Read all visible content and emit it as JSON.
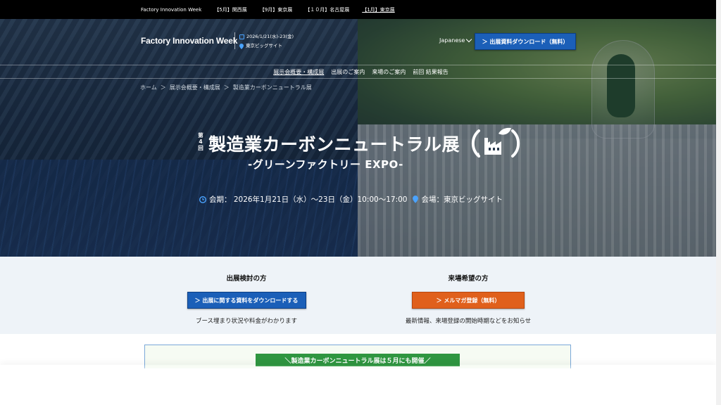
{
  "topbar": {
    "links": [
      {
        "label": "Factory Innovation Week",
        "active": false
      },
      {
        "label": "【5月】関西展",
        "active": false
      },
      {
        "label": "【9月】東京展",
        "active": false
      },
      {
        "label": "【１０月】名古屋展",
        "active": false
      },
      {
        "label": "【1月】東京展",
        "active": true
      }
    ]
  },
  "header": {
    "logo": "Factory Innovation Week",
    "date": "2026/1/21(水)-23(金)",
    "venue": "東京ビッグサイト",
    "language": "Japanese",
    "download_button": "＞ 出展資料ダウンロード（無料）"
  },
  "nav": {
    "items": [
      {
        "label": "展示会概要・構成展",
        "active": true
      },
      {
        "label": "出展のご案内",
        "active": false
      },
      {
        "label": "来場のご案内",
        "active": false
      },
      {
        "label": "前回 結果報告",
        "active": false
      }
    ]
  },
  "breadcrumb": {
    "items": [
      "ホーム",
      "＞",
      "展示会概要・構成展",
      "＞",
      "製造業カーボンニュートラル展"
    ]
  },
  "hero": {
    "edition": "第4回",
    "title": "製造業カーボンニュートラル展",
    "subtitle": "-グリーンファクトリー EXPO-",
    "period": "会期： 2026年1月21日（水）～23日（金）10:00～17:00",
    "venue": "会場：東京ビッグサイト"
  },
  "cta": {
    "exhibitor": {
      "heading": "出展検討の方",
      "button": "＞ 出展に関する資料をダウンロードする",
      "note": "ブース埋まり状況や料金がわかります"
    },
    "visitor": {
      "heading": "来場希望の方",
      "button": "＞ メルマガ登録（無料）",
      "note": "最新情報、来場登録の開始時期などをお知らせ"
    }
  },
  "notice": {
    "badge": "＼製造業カーボンニュートラル展は５月にも開催／"
  },
  "colors": {
    "primary_blue": "#1b5fb8",
    "cta_orange": "#e0601c",
    "notice_green": "#2f9640",
    "topbar": "#000000"
  }
}
